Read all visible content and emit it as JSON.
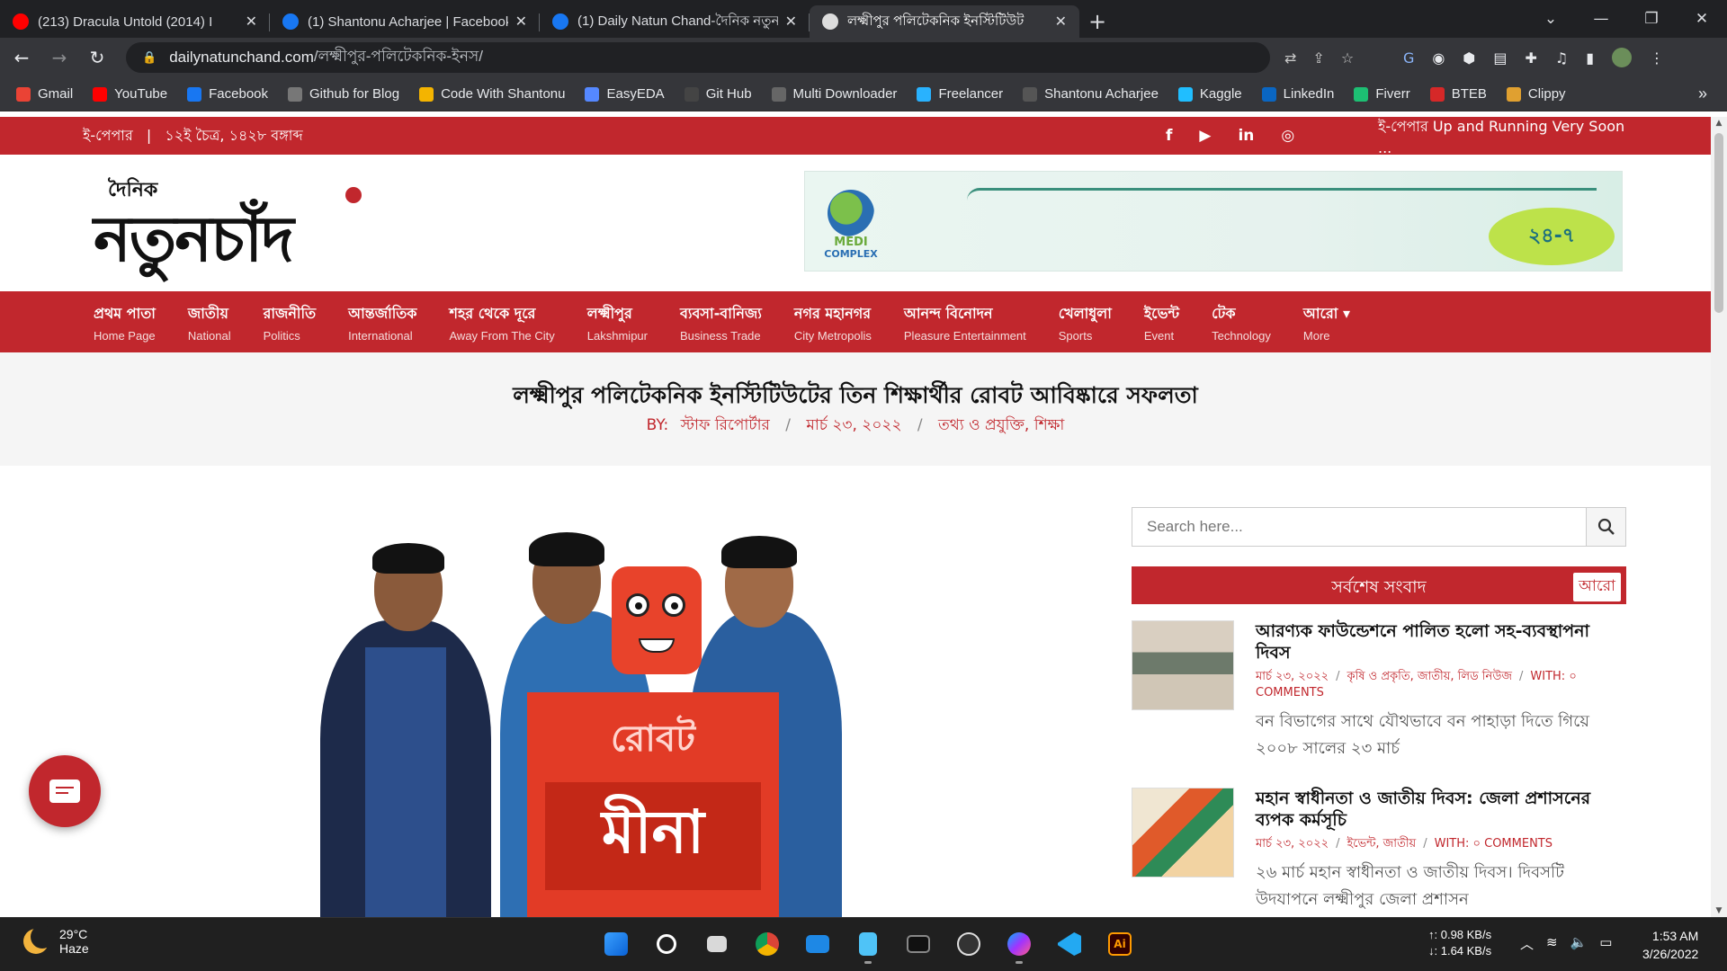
{
  "browser": {
    "tabs": [
      {
        "title": "(213) Dracula Untold (2014) I",
        "favicon": "youtube-icon",
        "color": "#ff0000",
        "active": false
      },
      {
        "title": "(1) Shantonu Acharjee | Facebook",
        "favicon": "facebook-icon",
        "color": "#1877f2",
        "active": false
      },
      {
        "title": "(1) Daily Natun Chand-দৈনিক নতুন",
        "favicon": "facebook-icon",
        "color": "#1877f2",
        "active": false
      },
      {
        "title": "লক্ষ্মীপুর পলিটেকনিক ইনস্টিটিউট",
        "favicon": "site-icon",
        "color": "#dddddd",
        "active": true
      }
    ],
    "url_host": "dailynatunchand.com",
    "url_path": "/লক্ষ্মীপুর-পলিটেকনিক-ইনস/",
    "bookmarks": [
      {
        "label": "Gmail",
        "icon": "gmail-icon",
        "color": "#ea4335"
      },
      {
        "label": "YouTube",
        "icon": "youtube-icon",
        "color": "#ff0000"
      },
      {
        "label": "Facebook",
        "icon": "facebook-icon",
        "color": "#1877f2"
      },
      {
        "label": "Github for Blog",
        "icon": "blog-icon",
        "color": "#777777"
      },
      {
        "label": "Code With Shantonu",
        "icon": "drive-icon",
        "color": "#f4b400"
      },
      {
        "label": "EasyEDA",
        "icon": "easyeda-icon",
        "color": "#5588ff"
      },
      {
        "label": "Git Hub",
        "icon": "github-icon",
        "color": "#444444"
      },
      {
        "label": "Multi Downloader",
        "icon": "globe-icon",
        "color": "#666666"
      },
      {
        "label": "Freelancer",
        "icon": "freelancer-icon",
        "color": "#29b2fe"
      },
      {
        "label": "Shantonu Acharjee",
        "icon": "profile-icon",
        "color": "#555555"
      },
      {
        "label": "Kaggle",
        "icon": "kaggle-icon",
        "color": "#20beff"
      },
      {
        "label": "LinkedIn",
        "icon": "linkedin-icon",
        "color": "#0a66c2"
      },
      {
        "label": "Fiverr",
        "icon": "fiverr-icon",
        "color": "#1dbf73"
      },
      {
        "label": "BTEB",
        "icon": "bteb-icon",
        "color": "#d62828"
      },
      {
        "label": "Clippy",
        "icon": "clippy-icon",
        "color": "#e0a030"
      }
    ]
  },
  "site": {
    "topbar": {
      "epaper": "ই-পেপার",
      "date": "১২ই চৈত্র, ১৪২৮ বঙ্গাব্দ",
      "marquee": "ই-পেপার Up and Running Very Soon ..."
    },
    "logo": {
      "small": "দৈনিক",
      "big": "নতুনচাঁদ"
    },
    "banner": {
      "brand_top": "MEDI",
      "brand_bottom": "COMPLEX",
      "hotline": "২৪-৭"
    },
    "nav": [
      {
        "bn": "প্রথম পাতা",
        "en": "Home Page"
      },
      {
        "bn": "জাতীয়",
        "en": "National"
      },
      {
        "bn": "রাজনীতি",
        "en": "Politics"
      },
      {
        "bn": "আন্তর্জাতিক",
        "en": "International"
      },
      {
        "bn": "শহর থেকে দূরে",
        "en": "Away From The City"
      },
      {
        "bn": "লক্ষ্মীপুর",
        "en": "Lakshmipur"
      },
      {
        "bn": "ব্যবসা-বানিজ্য",
        "en": "Business Trade"
      },
      {
        "bn": "নগর মহানগর",
        "en": "City Metropolis"
      },
      {
        "bn": "আনন্দ বিনোদন",
        "en": "Pleasure Entertainment"
      },
      {
        "bn": "খেলাধুলা",
        "en": "Sports"
      },
      {
        "bn": "ইভেন্ট",
        "en": "Event"
      },
      {
        "bn": "টেক",
        "en": "Technology"
      },
      {
        "bn": "আরো ▾",
        "en": "More"
      }
    ],
    "article": {
      "title": "লক্ষ্মীপুর পলিটেকনিক ইনস্টিটিউটের তিন শিক্ষার্থীর রোবট আবিষ্কারে সফলতা",
      "by_label": "BY:",
      "author": "স্টাফ রিপোর্টার",
      "date": "মার্চ ২৩, ২০২২",
      "categories": "তথ্য ও প্রযুক্তি, শিক্ষা",
      "robot_label1": "রোবট",
      "robot_label2": "মীনা"
    },
    "sidebar": {
      "search_placeholder": "Search here...",
      "latest_heading": "সর্বশেষ সংবাদ",
      "latest_more": "আরো",
      "posts": [
        {
          "title": "আরণ্যক ফাউন্ডেশনে পালিত হলো সহ-ব্যবস্থাপনা দিবস",
          "date": "মার্চ ২৩, ২০২২",
          "cats": "কৃষি ও প্রকৃতি, জাতীয়, লিড নিউজ",
          "with": "WITH: ০ COMMENTS",
          "excerpt": "বন বিভাগের সাথে যৌথভাবে বন পাহাড়া দিতে গিয়ে ২০০৮ সালের ২৩ মার্চ"
        },
        {
          "title": "মহান স্বাধীনতা ও জাতীয় দিবস: জেলা প্রশাসনের ব্যপক কর্মসূচি",
          "date": "মার্চ ২৩, ২০২২",
          "cats": "ইভেন্ট, জাতীয়",
          "with": "WITH: ০ COMMENTS",
          "excerpt": "২৬ মার্চ মহান স্বাধীনতা ও জাতীয় দিবস। দিবসটি উদযাপনে লক্ষ্মীপুর জেলা প্রশাসন"
        }
      ]
    }
  },
  "taskbar": {
    "weather_temp": "29°C",
    "weather_desc": "Haze",
    "net_up": "↑: 0.98 KB/s",
    "net_down": "↓: 1.64 KB/s",
    "time": "1:53 AM",
    "date": "3/26/2022"
  }
}
